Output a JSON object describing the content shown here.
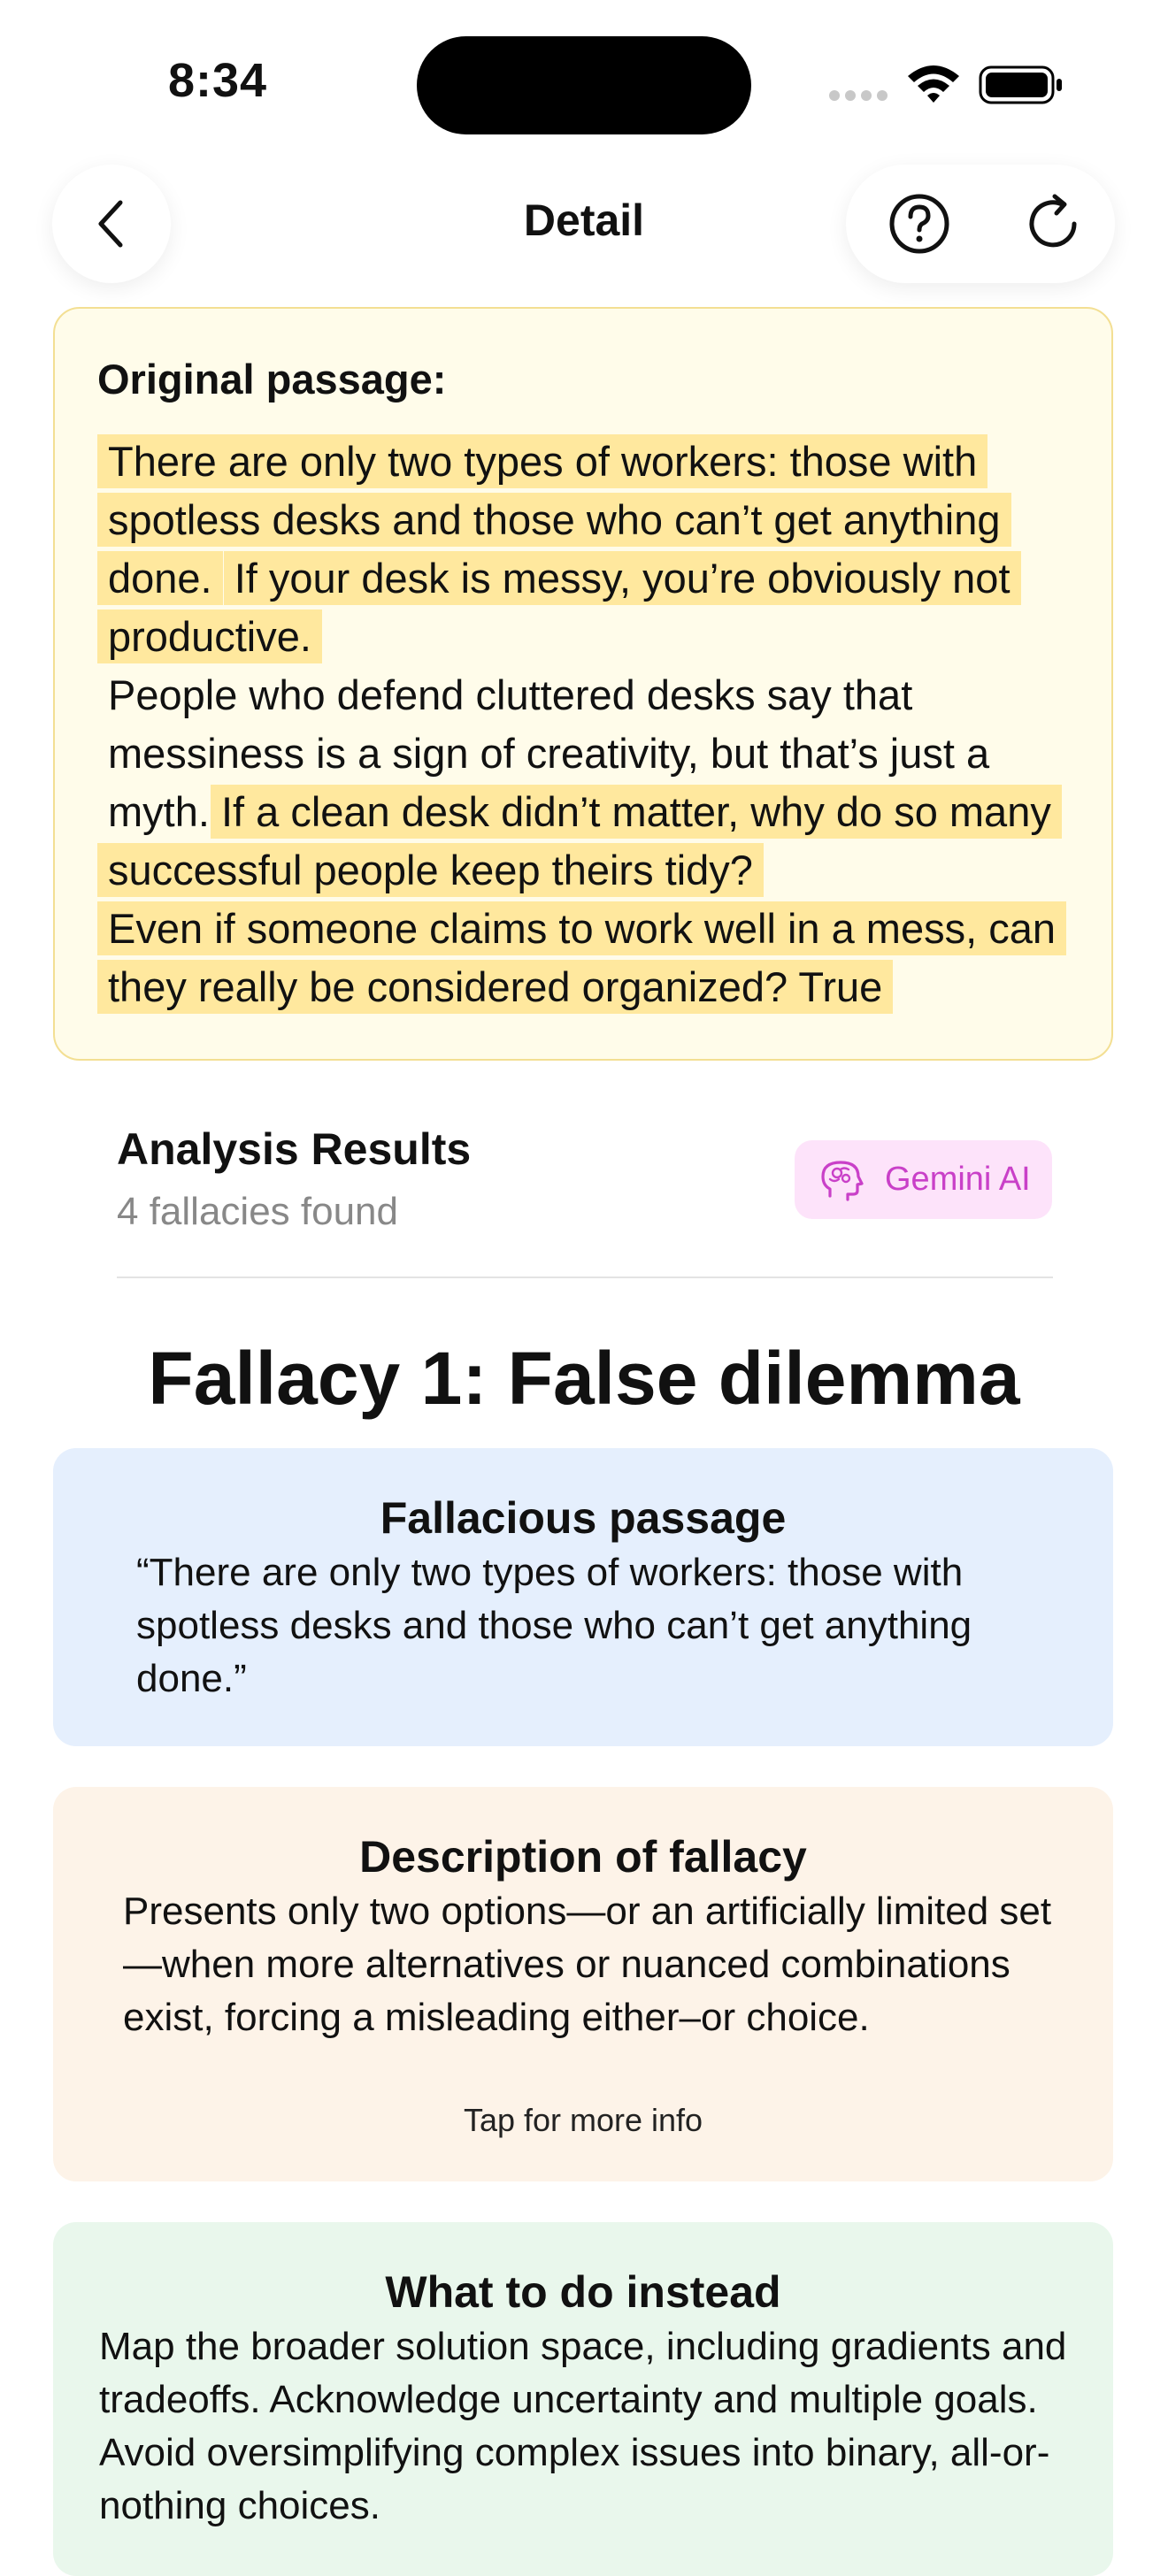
{
  "status_bar": {
    "time": "8:34"
  },
  "header": {
    "title": "Detail"
  },
  "passage": {
    "label": "Original passage:",
    "segments": [
      {
        "text": "There are only two types of workers: those with spotless desks and those who can’t get anything done.",
        "highlighted": true
      },
      {
        "text": " ",
        "highlighted": false
      },
      {
        "text": "If your desk is messy, you’re obviously not productive.",
        "highlighted": true
      },
      {
        "text": "People who defend cluttered desks say that messiness is a sign of creativity, but that’s just a myth. ",
        "highlighted": false
      },
      {
        "text": "If a clean desk didn’t matter, why do so many successful people keep theirs tidy?",
        "highlighted": true
      },
      {
        "text": "Even if someone claims to work well in a mess, can they really be considered organized? True",
        "highlighted": true
      }
    ]
  },
  "results": {
    "title": "Analysis Results",
    "subtitle": "4 fallacies found",
    "badge_label": "Gemini AI"
  },
  "fallacy": {
    "heading": "Fallacy 1: False dilemma",
    "passage_card": {
      "title": "Fallacious passage",
      "body": "“There are only two types of workers: those with spotless desks and those who can’t get anything done.”"
    },
    "description_card": {
      "title": "Description of fallacy",
      "body": "Presents only two options—or an artificially limited set—when more alternatives or nuanced combinations exist, forcing a misleading either–or choice.",
      "more": "Tap for more info"
    },
    "instead_card": {
      "title": "What to do instead",
      "body": "Map the broader solution space, including gradients and tradeoffs. Acknowledge uncertainty and multiple goals. Avoid oversimplifying complex issues into binary, all-or-nothing choices."
    }
  },
  "colors": {
    "highlight": "#ffe89e",
    "passage_bg": "#fffcea",
    "blue_card": "#e5effd",
    "orange_card": "#fdf3e8",
    "green_card": "#e9f7ec",
    "gemini_accent": "#c940c8"
  },
  "icons": {
    "back": "chevron-left-icon",
    "help": "question-circle-icon",
    "refresh": "refresh-icon",
    "gemini": "brain-icon"
  }
}
